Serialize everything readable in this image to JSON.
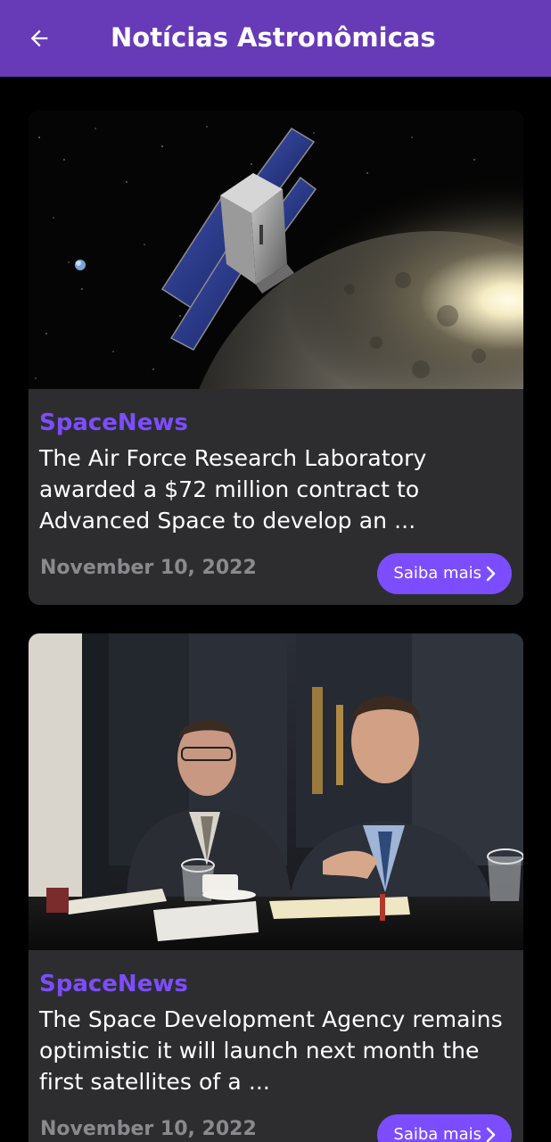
{
  "appbar": {
    "title": "Notícias Astronômicas",
    "back_icon": "arrow-left-icon"
  },
  "colors": {
    "appbar": "#673ab7",
    "background": "#000000",
    "card": "#2d2d30",
    "accent": "#7c4dff",
    "date": "#8a8a8e"
  },
  "articles": [
    {
      "source": "SpaceNews",
      "summary": "The Air Force Research Laboratory awarded a $72 million contract to Advanced Space to develop an ...",
      "date": "November 10, 2022",
      "button_label": "Saiba mais",
      "button_icon": "chevron-right-icon",
      "image": "satellite-over-moon-image"
    },
    {
      "source": "SpaceNews",
      "summary": "The Space Development Agency remains optimistic it will launch next month the first satellites of a ...",
      "date": "November 10, 2022",
      "button_label": "Saiba mais",
      "button_icon": "chevron-right-icon",
      "image": "press-conference-photo"
    }
  ]
}
